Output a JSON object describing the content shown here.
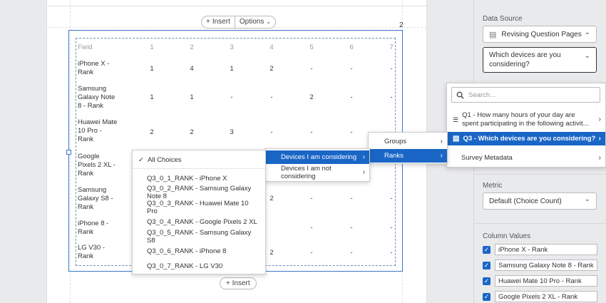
{
  "toolbar": {
    "insert_label": "Insert",
    "options_label": "Options",
    "insert_bottom_label": "Insert",
    "block_number": "2"
  },
  "table": {
    "headers": [
      "Field",
      "1",
      "2",
      "3",
      "4",
      "5",
      "6",
      "7"
    ],
    "rows": [
      {
        "label": "iPhone X - Rank",
        "cells": [
          "1",
          "4",
          "1",
          "2",
          "-",
          "-",
          "-"
        ]
      },
      {
        "label": "Samsung Galaxy Note 8 - Rank",
        "cells": [
          "1",
          "1",
          "-",
          "-",
          "2",
          "-",
          "-"
        ]
      },
      {
        "label": "Huawei Mate 10 Pro - Rank",
        "cells": [
          "2",
          "2",
          "3",
          "-",
          "-",
          "-",
          "-"
        ]
      },
      {
        "label": "Google Pixels 2 XL - Rank",
        "cells": [
          "",
          "",
          "",
          "",
          "",
          "",
          ""
        ]
      },
      {
        "label": "Samsung Galaxy S8 - Rank",
        "cells": [
          "",
          "",
          "",
          "2",
          "-",
          "-",
          "-"
        ]
      },
      {
        "label": "iPhone 8 - Rank",
        "cells": [
          "",
          "",
          "",
          "-",
          "-",
          "-",
          "-"
        ]
      },
      {
        "label": "LG V30 - Rank",
        "cells": [
          "",
          "",
          "",
          "2",
          "-",
          "-",
          "-"
        ]
      }
    ]
  },
  "panel": {
    "data_source_label": "Data Source",
    "data_source_value": "Revising Question Pages",
    "question_value": "Which devices are you considering?",
    "metric_label": "Metric",
    "metric_value": "Default (Choice Count)",
    "column_values_label": "Column Values",
    "column_values": [
      "iPhone X - Rank",
      "Samsung Galaxy Note 8 - Rank",
      "Huawei Mate 10 Pro - Rank",
      "Google Pixels 2 XL - Rank"
    ]
  },
  "question_menu": {
    "search_placeholder": "Search...",
    "items": [
      {
        "label": "Q1 - How many hours of your day are spent participating in the following activit..."
      },
      {
        "label": "Q3 - Which devices are you considering?"
      },
      {
        "label": "Survey Metadata"
      }
    ]
  },
  "type_menu": {
    "items": [
      "Groups",
      "Ranks"
    ]
  },
  "set_menu": {
    "items": [
      "Devices I am considering",
      "Devices I am not considering"
    ]
  },
  "choice_menu": {
    "all_label": "All Choices",
    "items": [
      "Q3_0_1_RANK - iPhone X",
      "Q3_0_2_RANK - Samsung Galaxy Note 8",
      "Q3_0_3_RANK - Huawei Mate 10 Pro",
      "Q3_0_4_RANK - Google Pixels 2 XL",
      "Q3_0_5_RANK - Samsung Galaxy S8",
      "Q3_0_6_RANK - iPhone 8",
      "Q3_0_7_RANK - LG V30"
    ]
  }
}
